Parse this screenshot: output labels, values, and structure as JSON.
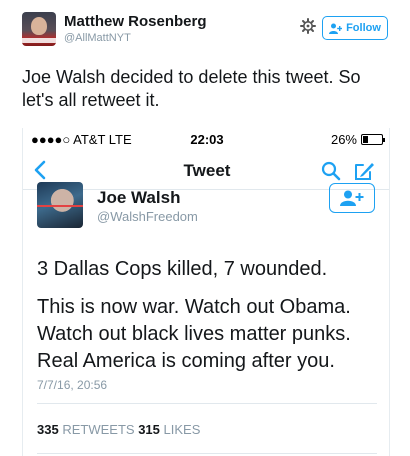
{
  "outer": {
    "name": "Matthew Rosenberg",
    "handle": "@AllMattNYT",
    "follow_label": "Follow",
    "text": "Joe Walsh decided to delete this tweet. So let's all retweet it."
  },
  "phone": {
    "status": {
      "carrier": "●●●●○ AT&T  LTE",
      "time": "22:03",
      "battery": "26%"
    },
    "nav_title": "Tweet",
    "tweet": {
      "name": "Joe Walsh",
      "handle": "@WalshFreedom",
      "line1": "3 Dallas Cops killed, 7 wounded.",
      "line2": "This is now war. Watch out Obama.",
      "line3": "Watch out black lives matter punks.",
      "line4": "Real America is coming after you.",
      "date": "7/7/16, 20:56",
      "retweets_count": "335",
      "retweets_label": "RETWEETS",
      "likes_count": "315",
      "likes_label": "LIKES"
    }
  },
  "colors": {
    "accent": "#1da1f2",
    "text": "#14171a",
    "muted": "#8899a6"
  }
}
